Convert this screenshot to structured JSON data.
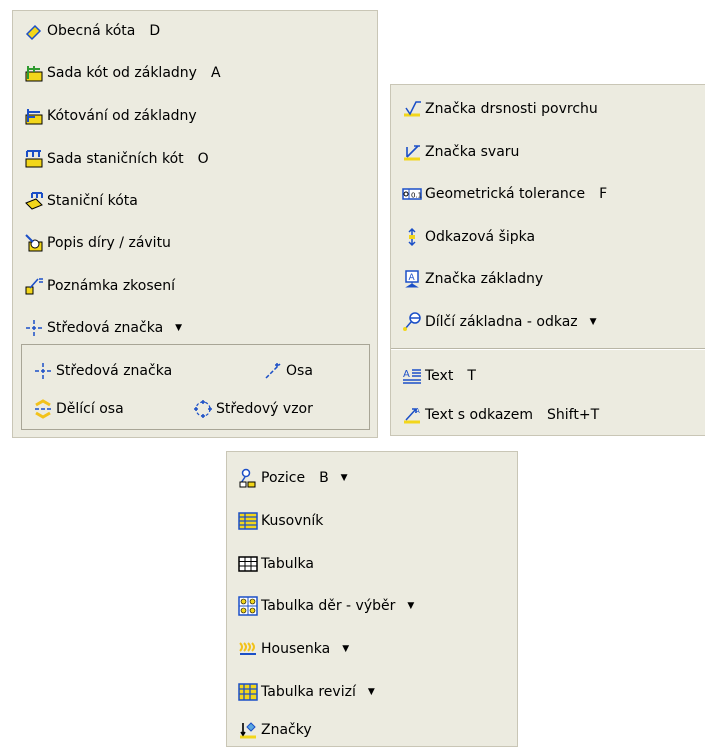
{
  "left_menu": {
    "items": [
      {
        "label": "Obecná kóta",
        "key": "D"
      },
      {
        "label": "Sada kót od základny",
        "key": "A"
      },
      {
        "label": "Kótování od základny",
        "key": ""
      },
      {
        "label": "Sada staničních kót",
        "key": "O"
      },
      {
        "label": "Staniční kóta",
        "key": ""
      },
      {
        "label": "Popis díry / závitu",
        "key": ""
      },
      {
        "label": "Poznámka zkosení",
        "key": ""
      },
      {
        "label": "Středová značka",
        "key": ""
      }
    ],
    "flyout": {
      "center_mark": "Středová značka",
      "axis": "Osa",
      "bisector": "Dělící osa",
      "pattern": "Středový vzor"
    }
  },
  "right_menu": {
    "items": [
      {
        "label": "Značka drsnosti povrchu",
        "key": ""
      },
      {
        "label": "Značka svaru",
        "key": ""
      },
      {
        "label": "Geometrická tolerance",
        "key": "F"
      },
      {
        "label": "Odkazová šipka",
        "key": ""
      },
      {
        "label": "Značka základny",
        "key": ""
      },
      {
        "label": "Dílčí základna - odkaz",
        "key": ""
      }
    ],
    "text_items": [
      {
        "label": "Text",
        "key": "T"
      },
      {
        "label": "Text s odkazem",
        "key": "Shift+T"
      }
    ]
  },
  "bottom_menu": {
    "items": [
      {
        "label": "Pozice",
        "key": "B"
      },
      {
        "label": "Kusovník",
        "key": ""
      },
      {
        "label": "Tabulka",
        "key": ""
      },
      {
        "label": "Tabulka děr - výběr",
        "key": ""
      },
      {
        "label": "Housenka",
        "key": ""
      },
      {
        "label": "Tabulka revizí",
        "key": ""
      },
      {
        "label": "Značky",
        "key": ""
      }
    ]
  },
  "colors": {
    "panel_bg": "#ecebe0",
    "icon_blue": "#1b4fc7",
    "icon_yellow": "#f2d61b",
    "icon_green": "#2f9a2f"
  }
}
